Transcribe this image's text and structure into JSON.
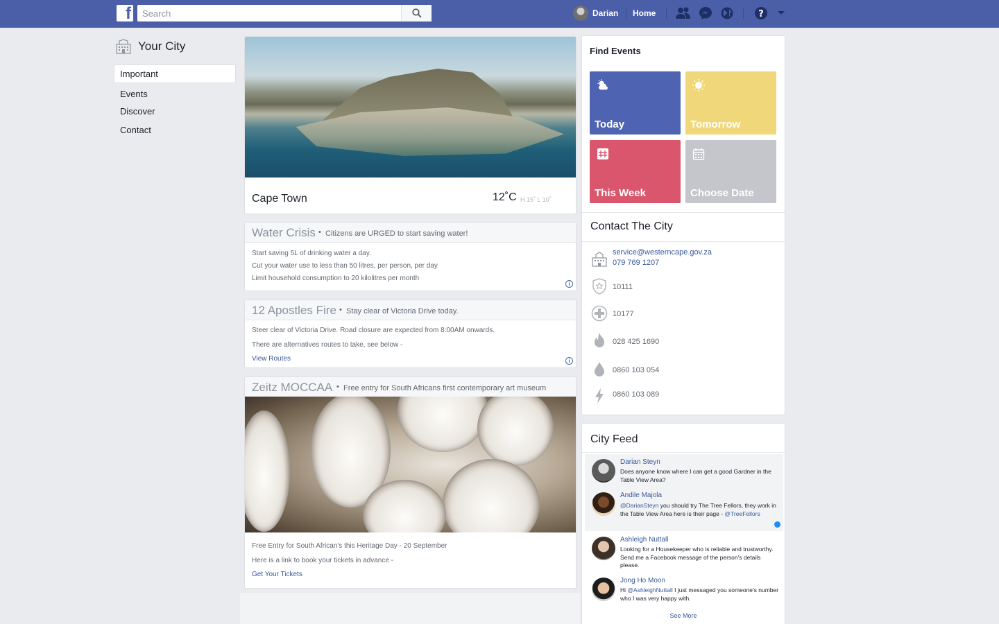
{
  "topbar": {
    "logo": "f",
    "search_placeholder": "Search",
    "user_name": "Darian",
    "home_label": "Home",
    "icons": [
      "friends-icon",
      "messenger-icon",
      "globe-icon",
      "help-icon",
      "dropdown-icon"
    ],
    "bar_color": "#4b5fa8"
  },
  "sidebar": {
    "title": "Your City",
    "items": [
      {
        "label": "Important",
        "active": true
      },
      {
        "label": "Events",
        "active": false
      },
      {
        "label": "Discover",
        "active": false
      },
      {
        "label": "Contact",
        "active": false
      }
    ]
  },
  "weather": {
    "place": "Cape Town",
    "temp": "12˚C",
    "hilo": "H 15˚  L 10˚"
  },
  "posts": [
    {
      "title": "Water Crisis",
      "subtitle": "Citizens are URGED to start saving water!",
      "lines": [
        "Start saving 5L of drinking water a day.",
        "Cut your water use to less than 50 litres, per person, per day",
        "Limit household consumption to 20 kilolitres per month"
      ]
    },
    {
      "title": "12 Apostles Fire",
      "subtitle": "Stay clear of Victoria Drive today.",
      "lines": [
        "Steer clear of Victoria Drive. Road closure are expected from 8:00AM onwards.",
        "There are alternatives routes to take, see below -"
      ],
      "link": "View Routes"
    },
    {
      "title": "Zeitz MOCCAA",
      "subtitle": "Free entry for South Africans first contemporary art museum",
      "lines": [
        "Free Entry for South African's this Heritage Day - 20 September",
        "Here is a link to book your tickets in advance -"
      ],
      "link": "Get Your Tickets"
    }
  ],
  "find_events": {
    "title": "Find Events",
    "tiles": [
      {
        "label": "Today",
        "color": "#4f63b3",
        "icon": "sun-cloud-icon"
      },
      {
        "label": "Tomorrow",
        "color": "#f0d87a",
        "icon": "sun-icon"
      },
      {
        "label": "This Week",
        "color": "#d9566c",
        "icon": "calendar-week-icon"
      },
      {
        "label": "Choose Date",
        "color": "#c4c6cc",
        "icon": "calendar-icon"
      }
    ]
  },
  "contact": {
    "title": "Contact The City",
    "email": "service@westerncape.gov.za",
    "phone": "079 769 1207",
    "entries": [
      {
        "icon": "police-badge-icon",
        "value": "10111"
      },
      {
        "icon": "medical-cross-icon",
        "value": "10177"
      },
      {
        "icon": "fire-icon",
        "value": "028 425 1690"
      },
      {
        "icon": "water-drop-icon",
        "value": "0860 103 054"
      },
      {
        "icon": "lightning-icon",
        "value": "0860 103 089"
      }
    ]
  },
  "feed": {
    "title": "City Feed",
    "items": [
      {
        "name": "Darian Steyn",
        "text": "Does anyone know where I can get a good Gardner in the Table View Area?"
      },
      {
        "name": "Andile Majola",
        "mention": "@DarianSteyn",
        "text": " you should try The Tree Fellors, they work in the Table View Area here is their page - ",
        "mention2": "@TreeFellors"
      },
      {
        "name": "Ashleigh Nuttall",
        "text": "Looking for a Housekeeper who is reliable and trustworthy. Send me a Facebook message of the person's details please."
      },
      {
        "name": "Jong Ho Moon",
        "pre": "Hi ",
        "mention": "@AshleighNuttall",
        "text": " I just messaged you someone's number who I was very happy with."
      }
    ],
    "see_more": "See More"
  }
}
